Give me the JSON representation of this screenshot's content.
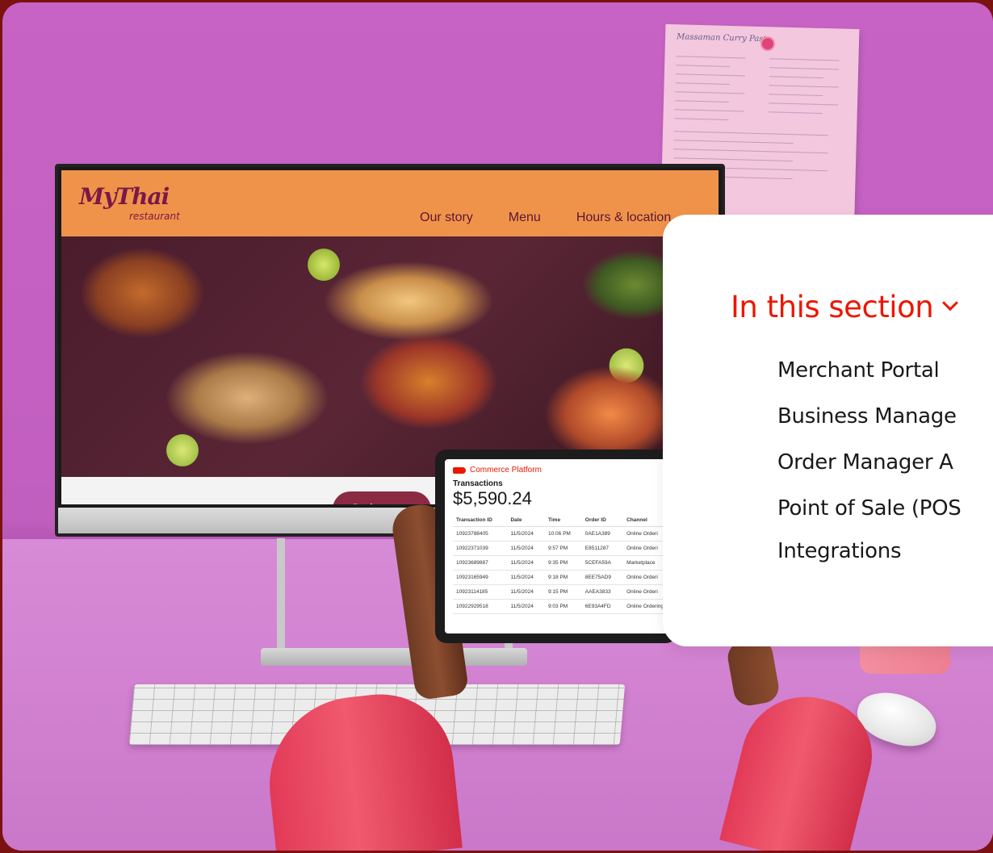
{
  "site": {
    "logo_main": "MyThai",
    "logo_sub": "restaurant",
    "nav": [
      "Our story",
      "Menu",
      "Hours & location"
    ],
    "order_button": "Order now"
  },
  "recipe_note": {
    "title": "Massaman Curry Paste"
  },
  "tablet": {
    "brand": "Commerce Platform",
    "label": "Transactions",
    "total": "$5,590.24",
    "columns": [
      "Transaction ID",
      "Date",
      "Time",
      "Order ID",
      "Channel"
    ],
    "rows": [
      [
        "10923788405",
        "11/5/2024",
        "10:06 PM",
        "0AE1A389",
        "Online Orderi"
      ],
      [
        "10922371039",
        "11/5/2024",
        "9:57 PM",
        "E8511287",
        "Online Orderi"
      ],
      [
        "10923689887",
        "11/5/2024",
        "9:35 PM",
        "5CEFA59A",
        "Marketplace"
      ],
      [
        "10923165949",
        "11/5/2024",
        "9:18 PM",
        "8EE75AD9",
        "Online Orderi"
      ],
      [
        "10923114185",
        "11/5/2024",
        "9:15 PM",
        "AAEA3833",
        "Online Orderi"
      ],
      [
        "10922929518",
        "11/5/2024",
        "9:03 PM",
        "6E93A4FD",
        "Online Ordering"
      ]
    ]
  },
  "section_menu": {
    "heading": "In this section",
    "items": [
      "Merchant Portal",
      "Business Manage",
      "Order Manager A",
      "Point of Sale (POS",
      "Integrations"
    ]
  },
  "colors": {
    "accent": "#eb1700",
    "background_frame": "#7a1210",
    "wall": "#c763c4",
    "site_header": "#f0934a",
    "order_button": "#8c2a44"
  }
}
